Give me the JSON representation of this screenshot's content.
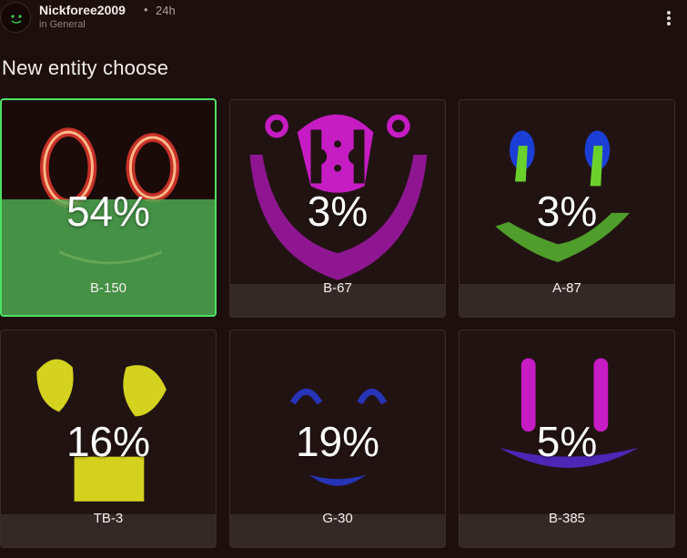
{
  "post": {
    "username": "Nickforee2009",
    "separator": "•",
    "time": "24h",
    "community": "in General",
    "title": "New entity choose"
  },
  "poll": {
    "options": [
      {
        "label": "B-150",
        "percent_text": "54%",
        "percent": 54,
        "selected": true
      },
      {
        "label": "B-67",
        "percent_text": "3%",
        "percent": 3,
        "selected": false
      },
      {
        "label": "A-87",
        "percent_text": "3%",
        "percent": 3,
        "selected": false
      },
      {
        "label": "TB-3",
        "percent_text": "16%",
        "percent": 16,
        "selected": false
      },
      {
        "label": "G-30",
        "percent_text": "19%",
        "percent": 19,
        "selected": false
      },
      {
        "label": "B-385",
        "percent_text": "5%",
        "percent": 5,
        "selected": false
      }
    ]
  },
  "colors": {
    "background": "#1d0f0d",
    "selected_border": "#4ee162",
    "vote_fill": "#4faf54"
  },
  "icons": [
    "avatar-icon",
    "more-options-icon"
  ]
}
